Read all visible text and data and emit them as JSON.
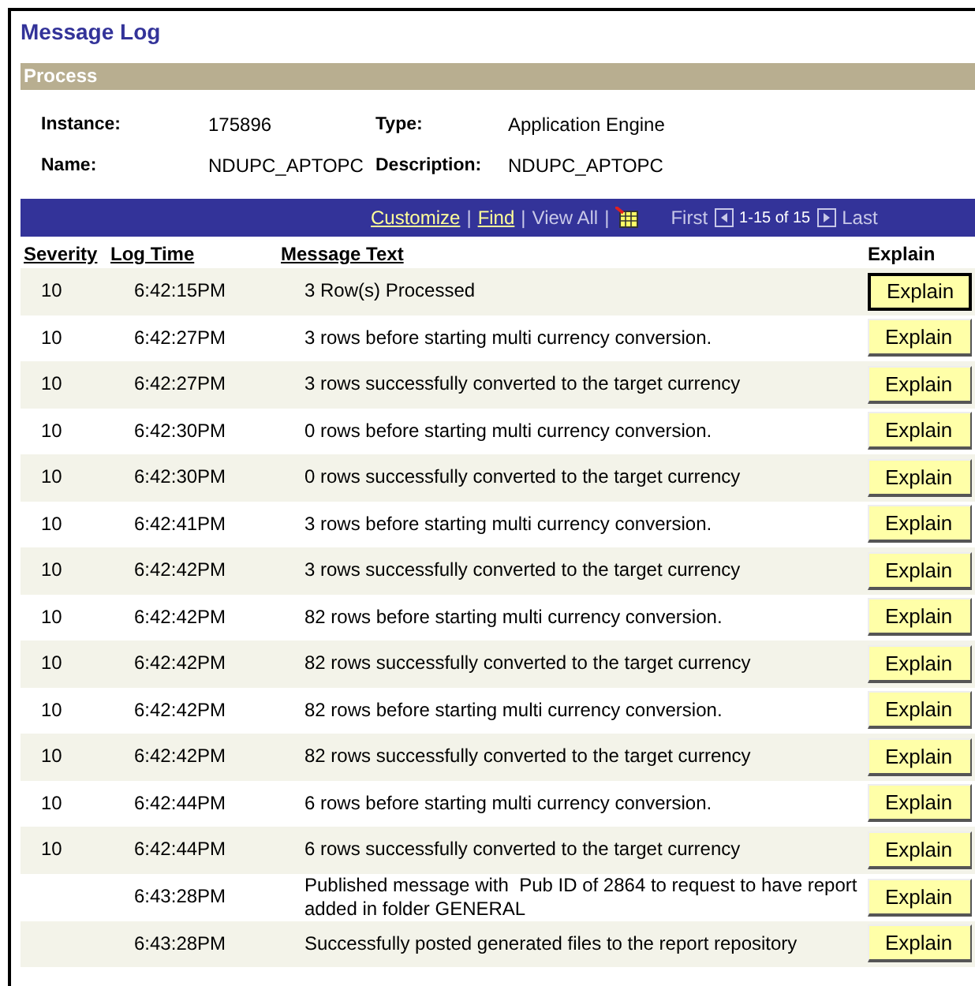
{
  "page": {
    "title": "Message Log"
  },
  "process": {
    "heading": "Process",
    "fields": [
      {
        "label": "Instance:",
        "value": "175896"
      },
      {
        "label": "Type:",
        "value": "Application Engine"
      },
      {
        "label": "Name:",
        "value": "NDUPC_APTOPC"
      },
      {
        "label": "Description:",
        "value": "NDUPC_APTOPC"
      }
    ]
  },
  "grid": {
    "toolbar": {
      "customize": "Customize",
      "find": "Find",
      "view_all": "View All",
      "separator": "|",
      "first": "First",
      "range": "1-15 of 15",
      "last": "Last"
    },
    "columns": [
      "Severity",
      "Log Time",
      "Message Text",
      "Explain"
    ],
    "rows": [
      {
        "severity": "10",
        "time": "6:42:15PM",
        "message": "3 Row(s) Processed",
        "button": "Explain"
      },
      {
        "severity": "10",
        "time": "6:42:27PM",
        "message": "3 rows before starting multi currency conversion.",
        "button": "Explain"
      },
      {
        "severity": "10",
        "time": "6:42:27PM",
        "message": "3 rows successfully converted to the target currency",
        "button": "Explain"
      },
      {
        "severity": "10",
        "time": "6:42:30PM",
        "message": "0 rows before starting multi currency conversion.",
        "button": "Explain"
      },
      {
        "severity": "10",
        "time": "6:42:30PM",
        "message": "0 rows successfully converted to the target currency",
        "button": "Explain"
      },
      {
        "severity": "10",
        "time": "6:42:41PM",
        "message": "3 rows before starting multi currency conversion.",
        "button": "Explain"
      },
      {
        "severity": "10",
        "time": "6:42:42PM",
        "message": "3 rows successfully converted to the target currency",
        "button": "Explain"
      },
      {
        "severity": "10",
        "time": "6:42:42PM",
        "message": "82 rows before starting multi currency conversion.",
        "button": "Explain"
      },
      {
        "severity": "10",
        "time": "6:42:42PM",
        "message": "82 rows successfully converted to the target currency",
        "button": "Explain"
      },
      {
        "severity": "10",
        "time": "6:42:42PM",
        "message": "82 rows before starting multi currency conversion.",
        "button": "Explain"
      },
      {
        "severity": "10",
        "time": "6:42:42PM",
        "message": "82 rows successfully converted to the target currency",
        "button": "Explain"
      },
      {
        "severity": "10",
        "time": "6:42:44PM",
        "message": "6 rows before starting multi currency conversion.",
        "button": "Explain"
      },
      {
        "severity": "10",
        "time": "6:42:44PM",
        "message": "6 rows successfully converted to the target currency",
        "button": "Explain"
      },
      {
        "time": "6:43:28PM",
        "message": "Published message with  Pub ID of 2864 to request to have report  added in folder GENERAL",
        "button": "Explain"
      },
      {
        "time": "6:43:28PM",
        "message": "Successfully posted generated files to the report repository",
        "button": "Explain"
      }
    ]
  }
}
